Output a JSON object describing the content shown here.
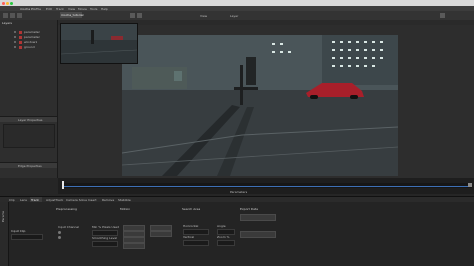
{
  "titlebar": {
    "app_menu": [
      "mocha Pro"
    ]
  },
  "menubar": {
    "items": [
      "mocha Pro",
      "File",
      "Edit",
      "Track",
      "View",
      "Movie",
      "Tools",
      "Help"
    ]
  },
  "toolbar": {
    "project_tab": "mocha_tutorial",
    "view_label": "View",
    "layer_label": "Layer"
  },
  "layer_panel": {
    "title": "Layers",
    "layers": [
      {
        "name": "parameter"
      },
      {
        "name": "parameter"
      },
      {
        "name": "window1"
      },
      {
        "name": "ground"
      }
    ],
    "layer_properties_label": "Layer Properties",
    "edge_properties_label": "Edge Properties"
  },
  "timeline": {
    "time_label": "Parameters"
  },
  "bottom": {
    "tabs": [
      "Clip",
      "Lens",
      "Track",
      "AdjustTrack",
      "Camera Solve",
      "Insert",
      "Remove",
      "Stabilize"
    ],
    "side_label": "Params",
    "groups": {
      "input_channel": "Input Channel",
      "preprocessing": "Preprocessing",
      "motion": "Motion",
      "search_area": "Search Area",
      "export_data": "Export Data",
      "min_pixels": "Min % Pixels Used",
      "smoothing": "Smoothing Level",
      "horizontal": "Horizontal",
      "vertical": "Vertical",
      "angle": "Angle",
      "zoom": "Zoom %",
      "input_clip": "Input Clip"
    }
  },
  "colors": {
    "accent": "#3d6fb5",
    "layer_swatch": "#b03535",
    "car": "#a81f2a"
  }
}
